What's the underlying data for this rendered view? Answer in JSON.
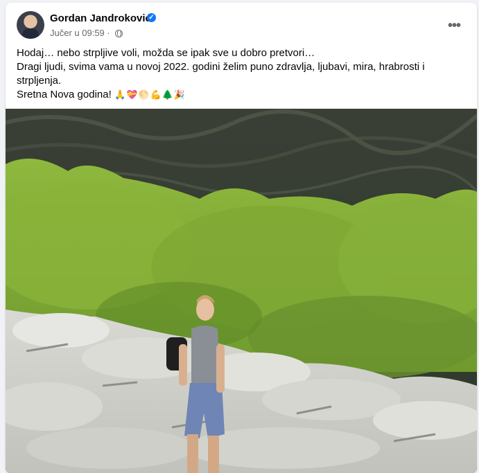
{
  "post": {
    "author": "Gordan Jandroković",
    "timestamp": "Jučer u 09:59",
    "separator": "·",
    "more_label": "•••",
    "lines": [
      "Hodaj… nebo strpljive voli, možda se ipak sve u dobro pretvori…",
      "Dragi ljudi, svima vama u novoj 2022. godini želim puno zdravlja, ljubavi, mira, hrabrosti i strpljenja.",
      "Sretna Nova godina!"
    ],
    "emojis": [
      "🙏",
      "💝",
      "🌕",
      "💪",
      "🌲",
      "🎉"
    ]
  }
}
